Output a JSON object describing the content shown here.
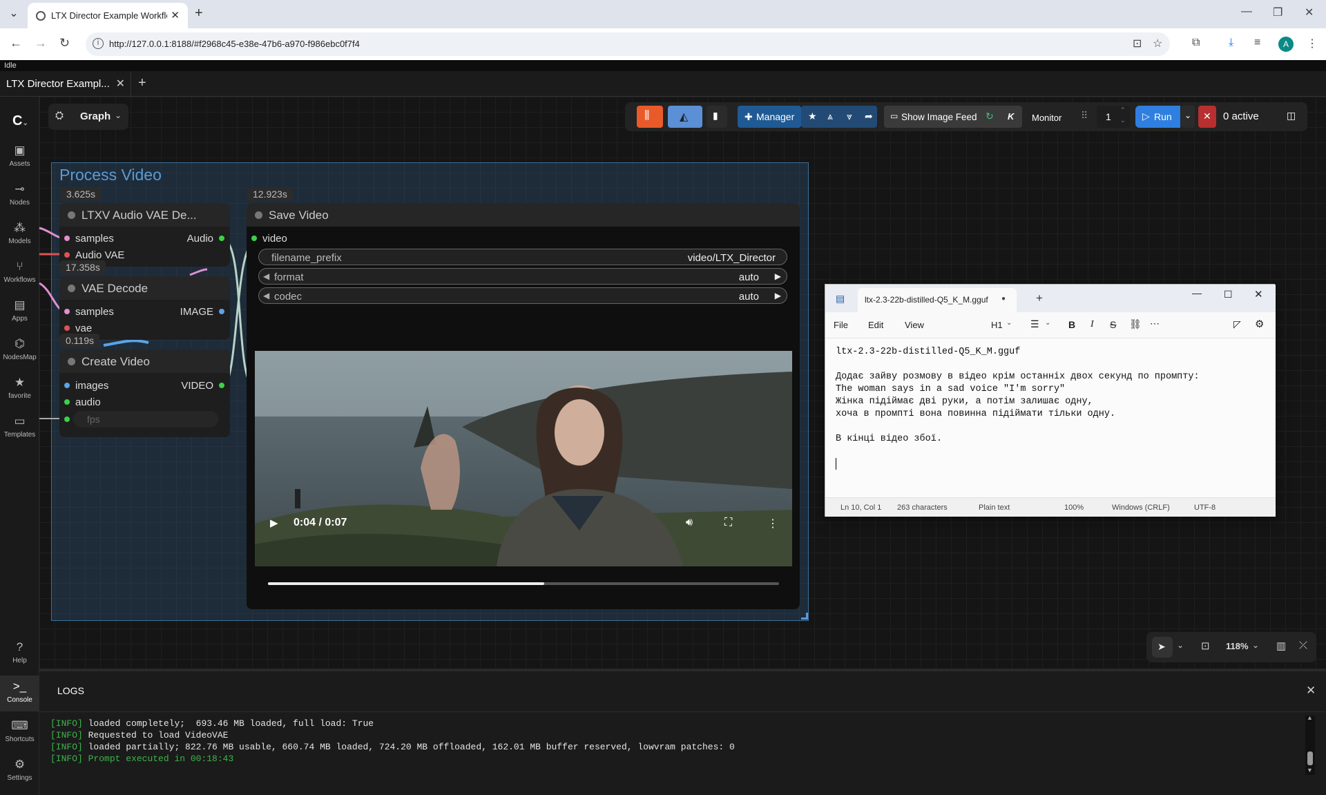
{
  "browser": {
    "tab_title": "LTX Director Example Workflow",
    "url": "http://127.0.0.1:8188/#f2968c45-e38e-47b6-a970-f986ebc0f7f4"
  },
  "app": {
    "status": "Idle",
    "workflow_tab": "LTX Director Exampl...",
    "graph_label": "Graph"
  },
  "sidebar": [
    {
      "label": "Assets",
      "icon": "assets-icon"
    },
    {
      "label": "Nodes",
      "icon": "nodes-icon"
    },
    {
      "label": "Models",
      "icon": "models-icon"
    },
    {
      "label": "Workflows",
      "icon": "workflows-icon"
    },
    {
      "label": "Apps",
      "icon": "apps-icon"
    },
    {
      "label": "NodesMap",
      "icon": "nodesmap-icon"
    },
    {
      "label": "favorite",
      "icon": "star-icon"
    },
    {
      "label": "Templates",
      "icon": "templates-icon"
    }
  ],
  "sidebar_bottom": [
    {
      "label": "Help"
    },
    {
      "label": "Console"
    },
    {
      "label": "Shortcuts"
    },
    {
      "label": "Settings"
    }
  ],
  "topbar": {
    "manager": "Manager",
    "image_feed": "Show Image Feed",
    "monitor": "Monitor",
    "batch": "1",
    "run": "Run",
    "active": "0 active"
  },
  "group": {
    "title": "Process Video"
  },
  "nodes": {
    "audio_vae": {
      "time": "3.625s",
      "title": "LTXV Audio VAE De...",
      "in1": "samples",
      "in2": "Audio VAE",
      "out": "Audio"
    },
    "vae_decode": {
      "time": "17.358s",
      "title": "VAE Decode",
      "in1": "samples",
      "in2": "vae",
      "out": "IMAGE"
    },
    "create_video": {
      "time": "0.119s",
      "title": "Create Video",
      "in1": "images",
      "in2": "audio",
      "in3": "fps",
      "out": "VIDEO"
    },
    "save_video": {
      "time": "12.923s",
      "title": "Save Video",
      "in1": "video",
      "filename_prefix_label": "filename_prefix",
      "filename_prefix_value": "video/LTX_Director",
      "format_label": "format",
      "format_value": "auto",
      "codec_label": "codec",
      "codec_value": "auto",
      "player_time": "0:04 / 0:07",
      "progress_fraction": 0.54
    }
  },
  "notepad": {
    "tab_title": "ltx-2.3-22b-distilled-Q5_K_M.gguf",
    "menu": [
      "File",
      "Edit",
      "View"
    ],
    "heading": "H1",
    "lines": [
      "ltx-2.3-22b-distilled-Q5_K_M.gguf",
      "",
      "Додає зайву розмову в відео крім останніх двох секунд по промпту:",
      "The woman says in a sad voice \"I'm sorry\"",
      "Жінка підіймає дві руки, а потім залишає одну,",
      "хоча в промпті вона повинна підіймати тільки одну.",
      "",
      "В кінці відео збої."
    ],
    "status": {
      "pos": "Ln 10, Col 1",
      "chars": "263 characters",
      "type": "Plain text",
      "zoom": "100%",
      "eol": "Windows (CRLF)",
      "enc": "UTF-8"
    }
  },
  "canvas_controls": {
    "zoom": "118%"
  },
  "console": {
    "title": "LOGS",
    "lines": [
      {
        "tag": "[INFO]",
        "text": "loaded completely;  693.46 MB loaded, full load: True",
        "color": "#e6e6e6"
      },
      {
        "tag": "[INFO]",
        "text": "Requested to load VideoVAE",
        "color": "#e6e6e6"
      },
      {
        "tag": "[INFO]",
        "text": "loaded partially; 822.76 MB usable, 660.74 MB loaded, 724.20 MB offloaded, 162.01 MB buffer reserved, lowvram patches: 0",
        "color": "#e6e6e6"
      },
      {
        "tag": "[INFO]",
        "text": "Prompt executed in 00:18:43",
        "color": "#3bb54a"
      }
    ]
  },
  "colors": {
    "accent_blue": "#2f7fe0",
    "manager_blue": "#1f5a94",
    "stop_red": "#b82f2f",
    "orange": "#e95a2b"
  }
}
